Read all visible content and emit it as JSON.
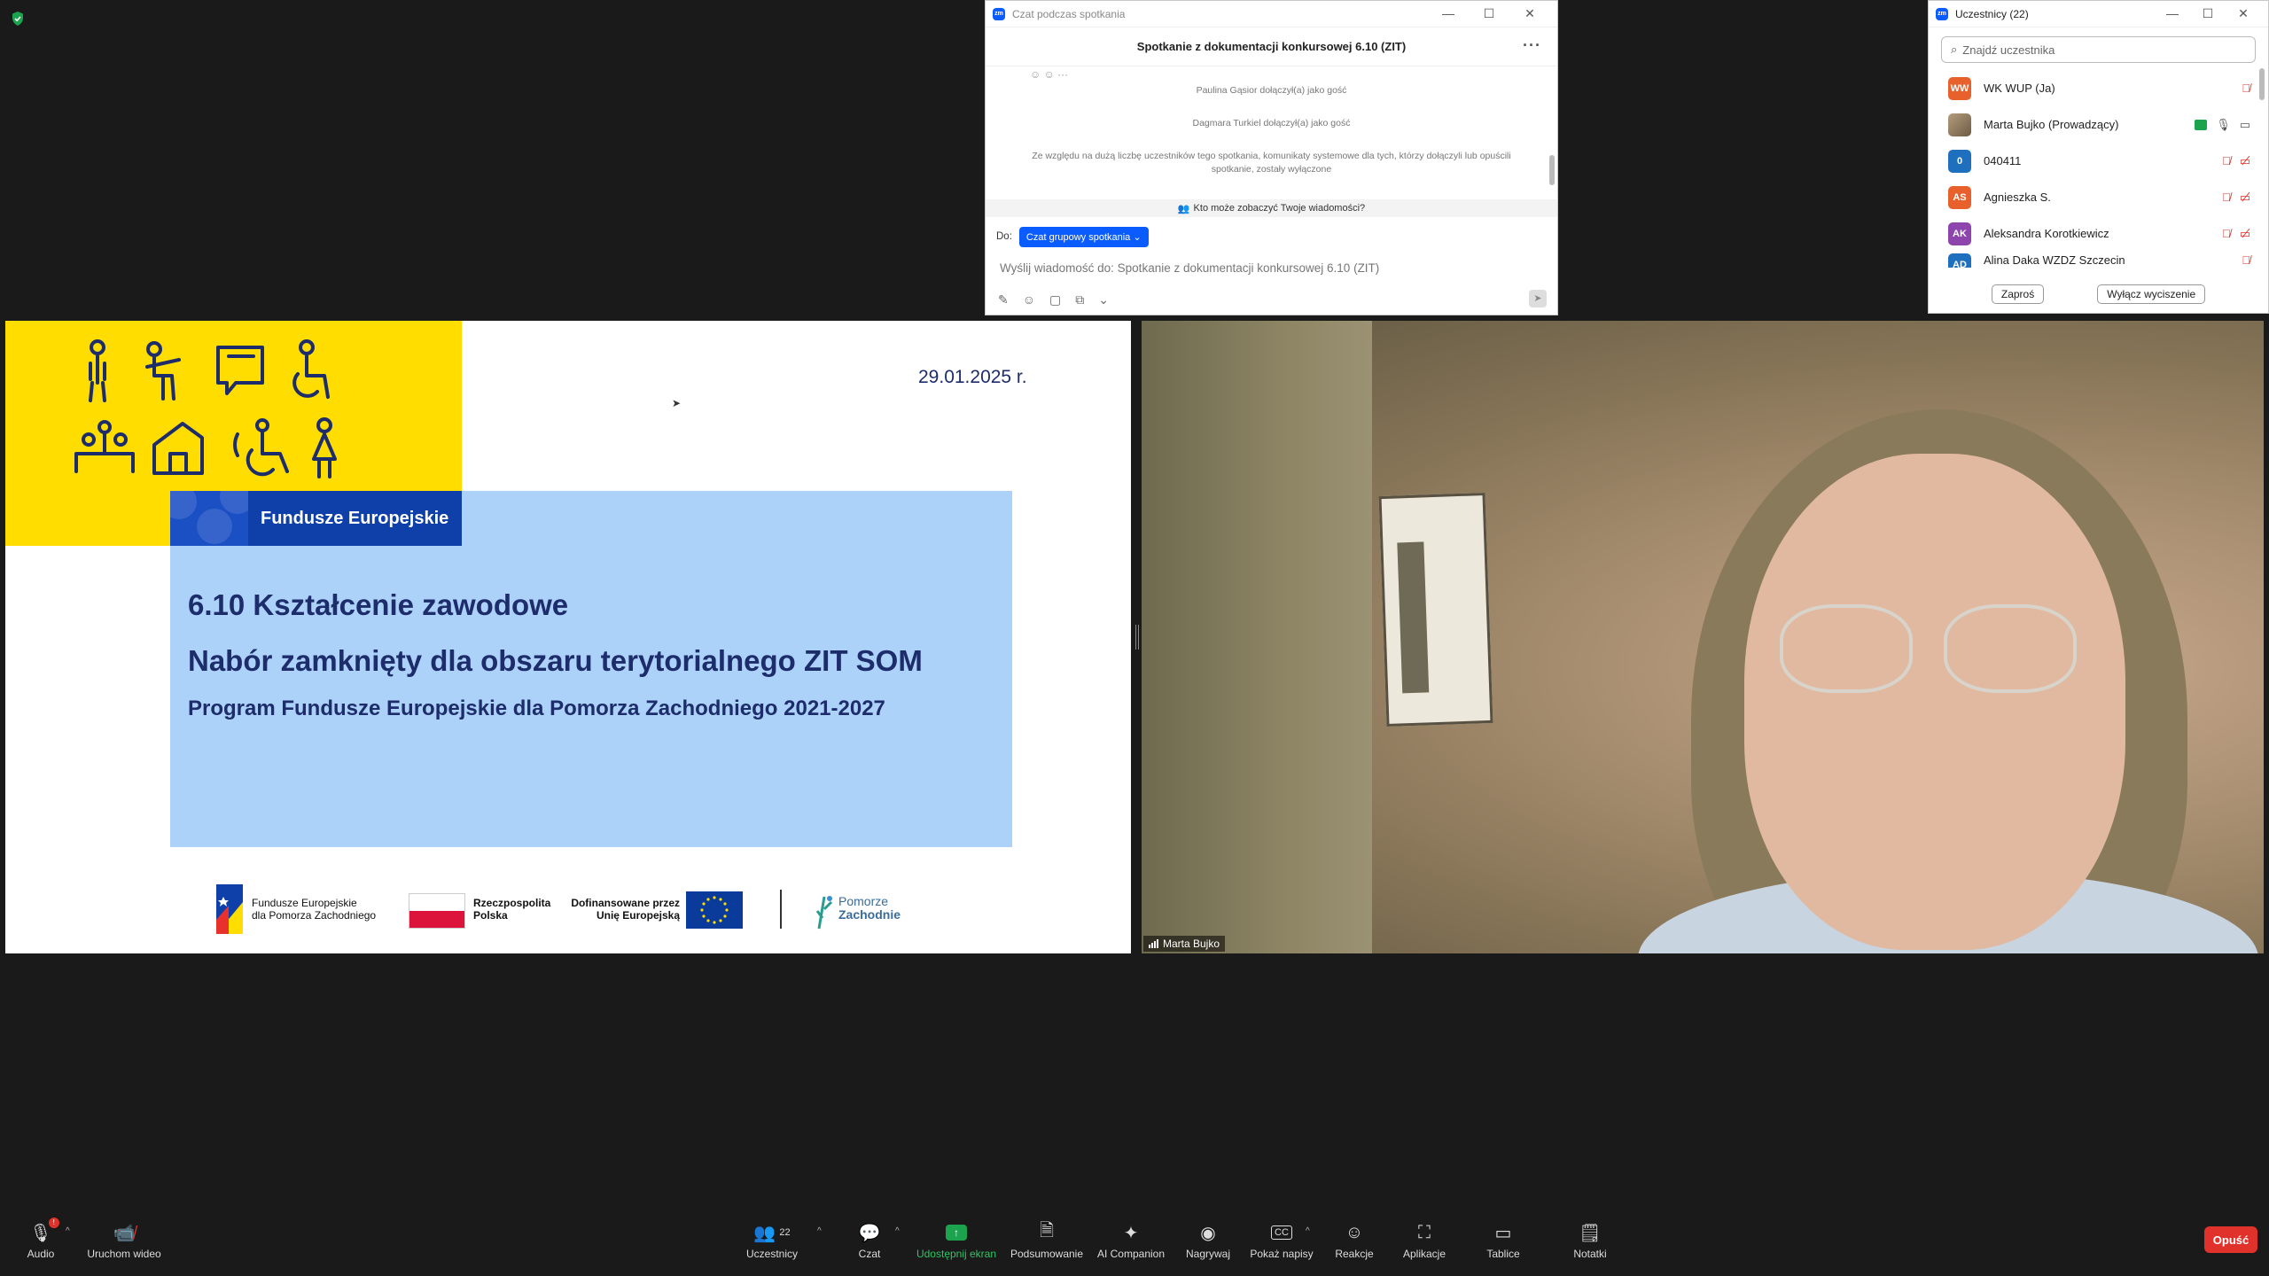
{
  "chat": {
    "window_title": "Czat podczas spotkania",
    "header": "Spotkanie z dokumentacji konkursowej 6.10 (ZIT)",
    "messages": [
      "Paulina Gąsior dołączył(a) jako gość",
      "Dagmara Turkiel dołączył(a) jako gość",
      "Ze względu na dużą liczbę uczestników tego spotkania, komunikaty systemowe dla tych, którzy dołączyli lub opuścili spotkanie, zostały wyłączone"
    ],
    "who_can_see": "Kto może zobaczyć Twoje wiadomości?",
    "to_label": "Do:",
    "to_target": "Czat grupowy spotkania",
    "input_placeholder": "Wyślij wiadomość do: Spotkanie z dokumentacji konkursowej 6.10 (ZIT)"
  },
  "participants": {
    "window_title": "Uczestnicy (22)",
    "search_placeholder": "Znajdź uczestnika",
    "list": [
      {
        "initials": "WW",
        "name": "WK WUP (Ja)",
        "color": "#e8612c"
      },
      {
        "initials": "",
        "name": "Marta Bujko (Prowadzący)",
        "color": "#9b8a6e"
      },
      {
        "initials": "0",
        "name": "040411",
        "color": "#1f6fbf"
      },
      {
        "initials": "AS",
        "name": "Agnieszka S.",
        "color": "#e8612c"
      },
      {
        "initials": "AK",
        "name": "Aleksandra Korotkiewicz",
        "color": "#8e44ad"
      },
      {
        "initials": "AD",
        "name": "Alina Daka WZDZ Szczecin",
        "color": "#1f6fbf"
      }
    ],
    "invite_button": "Zaproś",
    "mute_all_button": "Wyłącz wyciszenie"
  },
  "slide": {
    "date": "29.01.2025 r.",
    "badge": "Fundusze Europejskie",
    "title1": "6.10 Kształcenie zawodowe",
    "title2": "Nabór zamknięty dla obszaru terytorialnego ZIT SOM",
    "title3": "Program Fundusze Europejskie dla Pomorza Zachodniego 2021-2027",
    "logo_fe_line1": "Fundusze Europejskie",
    "logo_fe_line2": "dla Pomorza Zachodniego",
    "logo_rp_line1": "Rzeczpospolita",
    "logo_rp_line2": "Polska",
    "logo_eu_line1": "Dofinansowane przez",
    "logo_eu_line2": "Unię Europejską",
    "logo_pz_line1": "Pomorze",
    "logo_pz_line2": "Zachodnie"
  },
  "video": {
    "name": "Marta Bujko"
  },
  "toolbar": {
    "audio": "Audio",
    "video": "Uruchom wideo",
    "participants": "Uczestnicy",
    "participants_count": "22",
    "chat": "Czat",
    "share": "Udostępnij ekran",
    "summary": "Podsumowanie",
    "ai": "AI Companion",
    "record": "Nagrywaj",
    "captions": "Pokaż napisy",
    "reactions": "Reakcje",
    "apps": "Aplikacje",
    "whiteboards": "Tablice",
    "notes": "Notatki",
    "leave": "Opuść",
    "audio_badge": "!"
  }
}
